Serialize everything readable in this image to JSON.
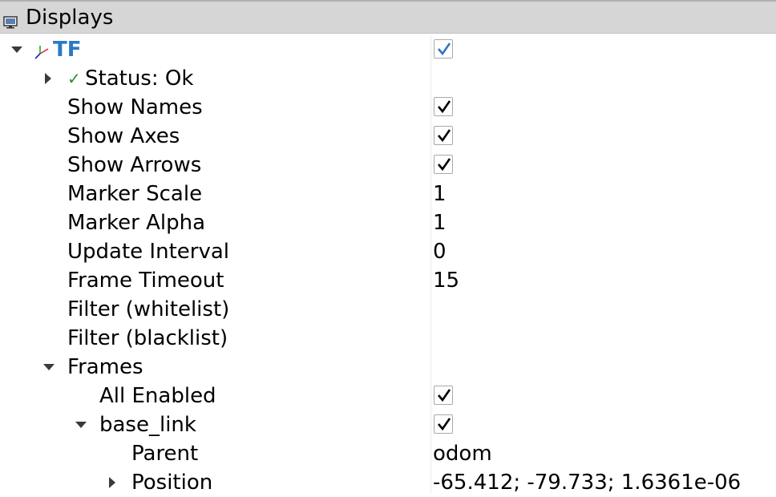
{
  "panel": {
    "title": "Displays",
    "icon": "monitor-icon"
  },
  "tree": {
    "tf": {
      "label": "TF",
      "checked": true,
      "icon": "tf-axes-icon"
    },
    "status": {
      "label": "Status: Ok",
      "icon": "check-icon"
    },
    "show_names": {
      "label": "Show Names",
      "checked": true
    },
    "show_axes": {
      "label": "Show Axes",
      "checked": true
    },
    "show_arrows": {
      "label": "Show Arrows",
      "checked": true
    },
    "marker_scale": {
      "label": "Marker Scale",
      "value": "1"
    },
    "marker_alpha": {
      "label": "Marker Alpha",
      "value": "1"
    },
    "update_interval": {
      "label": "Update Interval",
      "value": "0"
    },
    "frame_timeout": {
      "label": "Frame Timeout",
      "value": "15"
    },
    "filter_whitelist": {
      "label": "Filter (whitelist)",
      "value": ""
    },
    "filter_blacklist": {
      "label": "Filter (blacklist)",
      "value": ""
    },
    "frames": {
      "label": "Frames"
    },
    "all_enabled": {
      "label": "All Enabled",
      "checked": true
    },
    "base_link": {
      "label": "base_link",
      "checked": true
    },
    "parent": {
      "label": "Parent",
      "value": "odom"
    },
    "position": {
      "label": "Position",
      "value": "-65.412; -79.733; 1.6361e-06"
    }
  },
  "colors": {
    "tf_label": "#2b79c7",
    "status_check": "#2e8b2e",
    "titlebar_bg": "#d6d6d6"
  }
}
